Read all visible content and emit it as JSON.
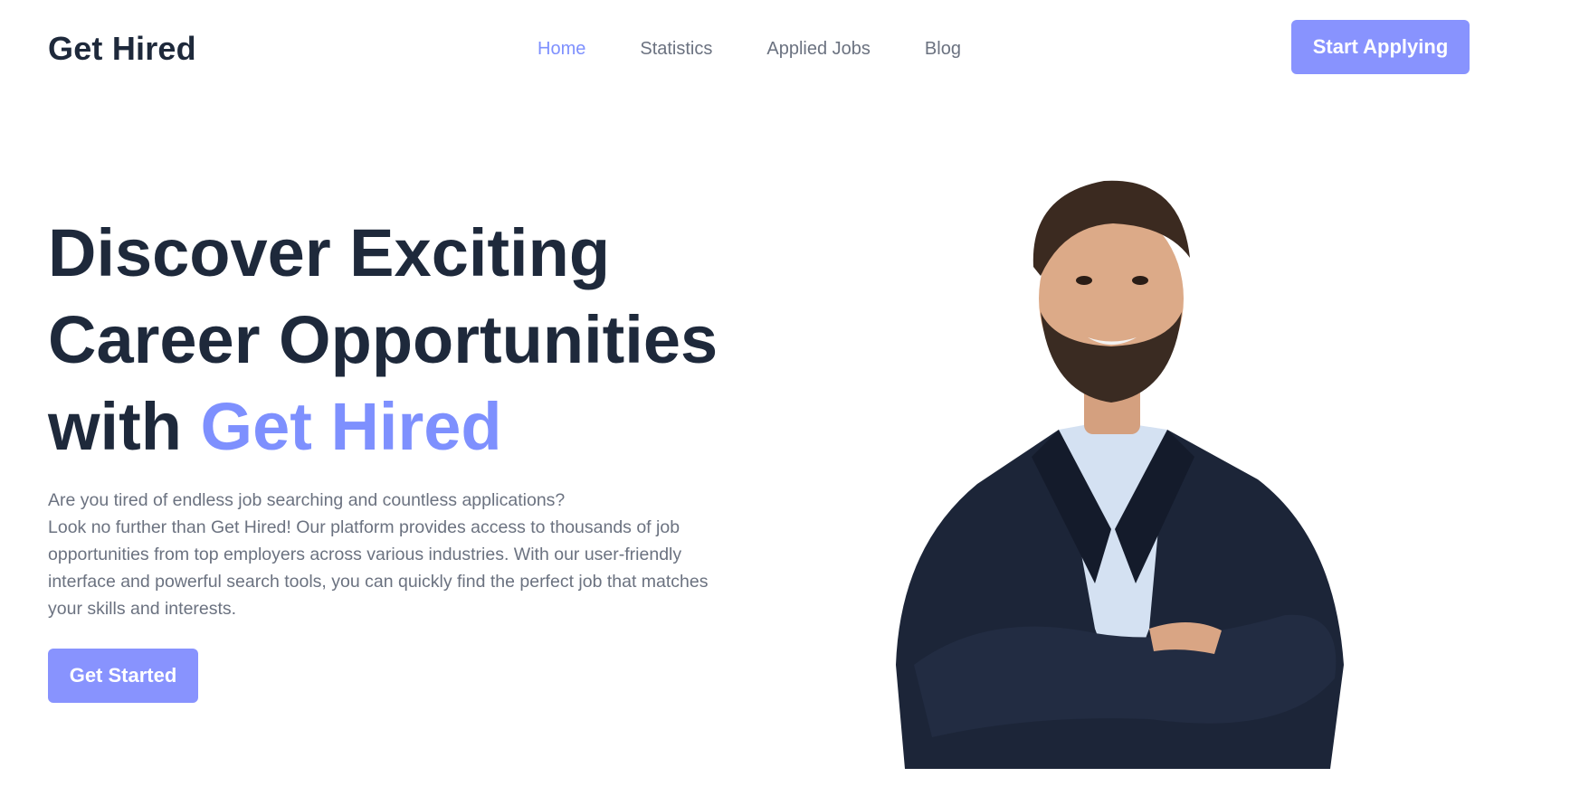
{
  "navbar": {
    "brand": "Get Hired",
    "links": [
      {
        "label": "Home",
        "active": true
      },
      {
        "label": "Statistics",
        "active": false
      },
      {
        "label": "Applied Jobs",
        "active": false
      },
      {
        "label": "Blog",
        "active": false
      }
    ],
    "cta_label": "Start Applying"
  },
  "hero": {
    "title_line1": "Discover Exciting",
    "title_line2": "Career Opportunities",
    "title_line3_prefix": "with",
    "title_line3_accent": "Get Hired",
    "description_line1": "Are you tired of endless job searching and countless applications?",
    "description_line2": "Look no further than Get Hired! Our platform provides access to thousands of job opportunities from top employers across various industries. With our user-friendly interface and powerful search tools, you can quickly find the perfect job that matches your skills and interests.",
    "cta_label": "Get Started"
  },
  "colors": {
    "accent": "#7e90fe",
    "button": "#8893fe",
    "heading": "#1e293b",
    "body_text": "#6b7280"
  }
}
